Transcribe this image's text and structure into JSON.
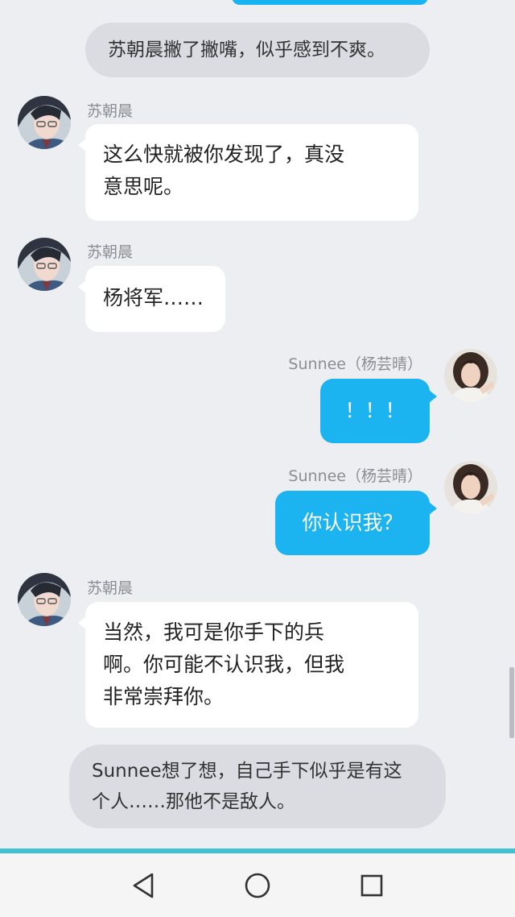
{
  "messages": [
    {
      "type": "narration",
      "text": "苏朝晨撇了撇嘴，似乎感到不爽。"
    },
    {
      "type": "incoming",
      "sender": "苏朝晨",
      "lines": [
        "这么快就被你发现了，真没",
        "意思呢。"
      ]
    },
    {
      "type": "incoming",
      "sender": "苏朝晨",
      "lines": [
        "杨将军……"
      ]
    },
    {
      "type": "outgoing",
      "sender": "Sunnee（杨芸晴）",
      "lines": [
        "！！！"
      ]
    },
    {
      "type": "outgoing",
      "sender": "Sunnee（杨芸晴）",
      "lines": [
        "你认识我？"
      ]
    },
    {
      "type": "incoming",
      "sender": "苏朝晨",
      "lines": [
        "当然，我可是你手下的兵",
        "啊。你可能不认识我，但我",
        "非常崇拜你。"
      ]
    },
    {
      "type": "narration",
      "lines": [
        "Sunnee想了想，自己手下似乎是有这",
        "个人……那他不是敌人。"
      ]
    }
  ],
  "navbar": {
    "back_icon": "triangle-back-icon",
    "home_icon": "circle-home-icon",
    "recents_icon": "square-recents-icon"
  },
  "colors": {
    "outgoing_bubble": "#1bb3f0",
    "incoming_bubble": "#ffffff",
    "narration_bubble": "#dadce2",
    "background": "#eceef2",
    "accent_bar": "#3dc2d6"
  }
}
